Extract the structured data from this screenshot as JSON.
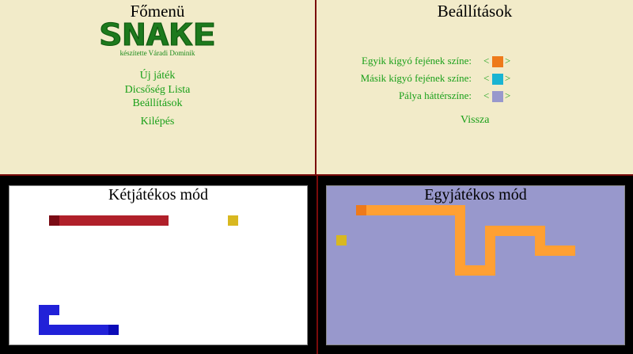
{
  "menu": {
    "title": "Főmenü",
    "logo_text": "SNAKE",
    "credit": "készítette Váradi Dominik",
    "items": [
      {
        "label": "Új játék"
      },
      {
        "label": "Dicsőség Lista"
      },
      {
        "label": "Beállítások"
      },
      {
        "label": "Kilépés"
      }
    ]
  },
  "settings": {
    "title": "Beállítások",
    "rows": [
      {
        "label": "Egyik kígyó fejének színe:",
        "left_arrow": "<",
        "right_arrow": ">",
        "color": "#ee7a1a"
      },
      {
        "label": "Másik kígyó fejének színe:",
        "left_arrow": "<",
        "right_arrow": ">",
        "color": "#1ab4d2"
      },
      {
        "label": "Pálya háttérszíne:",
        "left_arrow": "<",
        "right_arrow": ">",
        "color": "#9898cc"
      }
    ],
    "back_label": "Vissza"
  },
  "two_player": {
    "title": "Kétjátékos mód",
    "background": "#ffffff"
  },
  "one_player": {
    "title": "Egyjátékos mód",
    "background": "#9898cc"
  },
  "colors": {
    "panel_bg": "#f2ebc9",
    "divider": "#7a0b0b",
    "menu_text": "#1aa01a",
    "red_snake_body": "#b0202a",
    "red_snake_head": "#7a0b14",
    "blue_snake_body": "#2121d8",
    "blue_snake_head": "#0b0bb8",
    "orange_snake_body": "#ffa033",
    "orange_snake_head": "#ee7a1a",
    "food": "#d8b820"
  }
}
